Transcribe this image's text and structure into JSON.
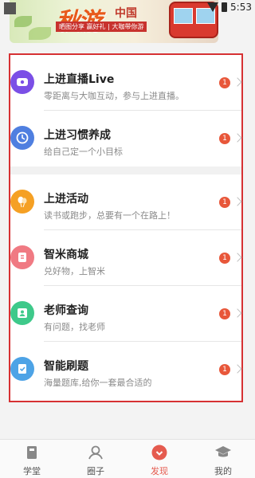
{
  "status_bar": {
    "time": "5:53"
  },
  "banner": {
    "title": "秋游",
    "subtitle": "中国",
    "strip_text": "晒图分享 赢好礼 | 大咖带你游"
  },
  "list": {
    "items": [
      {
        "title": "上进直播Live",
        "desc": "零距离与大咖互动，参与上进直播。",
        "badge": "1",
        "icon": "live-icon",
        "color": "#7b4fe6"
      },
      {
        "title": "上进习惯养成",
        "desc": "给自己定一个小目标",
        "badge": "1",
        "icon": "clock-icon",
        "color": "#4f7fe0"
      },
      {
        "title": "上进活动",
        "desc": "读书或跑步，总要有一个在路上！",
        "badge": "1",
        "icon": "balloon-icon",
        "color": "#f5a024"
      },
      {
        "title": "智米商城",
        "desc": "兑好物，上智米",
        "badge": "1",
        "icon": "shop-icon",
        "color": "#f07a83"
      },
      {
        "title": "老师查询",
        "desc": "有问题，找老师",
        "badge": "1",
        "icon": "teacher-icon",
        "color": "#3ec98a"
      },
      {
        "title": "智能刷题",
        "desc": "海量题库,给你一套最合适的",
        "badge": "1",
        "icon": "quiz-icon",
        "color": "#4da3e6"
      }
    ]
  },
  "bottom_nav": {
    "items": [
      {
        "label": "学堂",
        "icon": "book-icon",
        "active": false
      },
      {
        "label": "圈子",
        "icon": "people-icon",
        "active": false
      },
      {
        "label": "发现",
        "icon": "discover-icon",
        "active": true
      },
      {
        "label": "我的",
        "icon": "graduation-cap-icon",
        "active": false
      }
    ]
  },
  "colors": {
    "accent": "#e55b4f",
    "highlight_border": "#d63133",
    "badge": "#e8573a"
  }
}
